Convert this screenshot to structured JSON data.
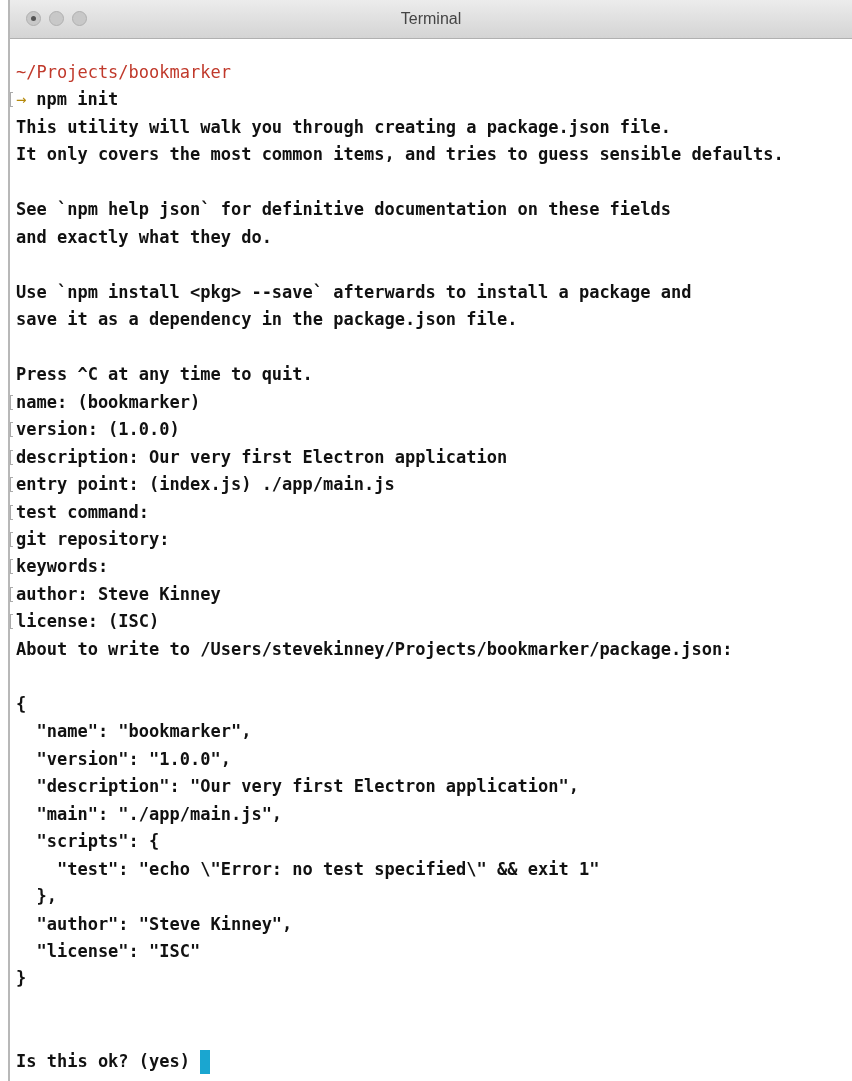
{
  "window": {
    "title": "Terminal"
  },
  "lines": [
    {
      "kind": "path",
      "text": "~/Projects/bookmarker",
      "marked": false
    },
    {
      "kind": "prompt",
      "symbol": "→",
      "text": "npm init",
      "marked": true
    },
    {
      "kind": "output",
      "text": "This utility will walk you through creating a package.json file.",
      "marked": false
    },
    {
      "kind": "output",
      "text": "It only covers the most common items, and tries to guess sensible defaults.",
      "marked": false
    },
    {
      "kind": "blank"
    },
    {
      "kind": "output",
      "text": "See `npm help json` for definitive documentation on these fields",
      "marked": false
    },
    {
      "kind": "output",
      "text": "and exactly what they do.",
      "marked": false
    },
    {
      "kind": "blank"
    },
    {
      "kind": "output",
      "text": "Use `npm install <pkg> --save` afterwards to install a package and",
      "marked": false
    },
    {
      "kind": "output",
      "text": "save it as a dependency in the package.json file.",
      "marked": false
    },
    {
      "kind": "blank"
    },
    {
      "kind": "output",
      "text": "Press ^C at any time to quit.",
      "marked": false
    },
    {
      "kind": "output",
      "text": "name: (bookmarker)",
      "marked": true
    },
    {
      "kind": "output",
      "text": "version: (1.0.0)",
      "marked": true
    },
    {
      "kind": "output",
      "text": "description: Our very first Electron application",
      "marked": true
    },
    {
      "kind": "output",
      "text": "entry point: (index.js) ./app/main.js",
      "marked": true
    },
    {
      "kind": "output",
      "text": "test command:",
      "marked": true
    },
    {
      "kind": "output",
      "text": "git repository:",
      "marked": true
    },
    {
      "kind": "output",
      "text": "keywords:",
      "marked": true
    },
    {
      "kind": "output",
      "text": "author: Steve Kinney",
      "marked": true
    },
    {
      "kind": "output",
      "text": "license: (ISC)",
      "marked": true
    },
    {
      "kind": "output",
      "text": "About to write to /Users/stevekinney/Projects/bookmarker/package.json:",
      "marked": false
    },
    {
      "kind": "blank"
    },
    {
      "kind": "output",
      "text": "{",
      "marked": false
    },
    {
      "kind": "output",
      "text": "  \"name\": \"bookmarker\",",
      "marked": false
    },
    {
      "kind": "output",
      "text": "  \"version\": \"1.0.0\",",
      "marked": false
    },
    {
      "kind": "output",
      "text": "  \"description\": \"Our very first Electron application\",",
      "marked": false
    },
    {
      "kind": "output",
      "text": "  \"main\": \"./app/main.js\",",
      "marked": false
    },
    {
      "kind": "output",
      "text": "  \"scripts\": {",
      "marked": false
    },
    {
      "kind": "output",
      "text": "    \"test\": \"echo \\\"Error: no test specified\\\" && exit 1\"",
      "marked": false
    },
    {
      "kind": "output",
      "text": "  },",
      "marked": false
    },
    {
      "kind": "output",
      "text": "  \"author\": \"Steve Kinney\",",
      "marked": false
    },
    {
      "kind": "output",
      "text": "  \"license\": \"ISC\"",
      "marked": false
    },
    {
      "kind": "output",
      "text": "}",
      "marked": false
    },
    {
      "kind": "blank"
    },
    {
      "kind": "blank"
    },
    {
      "kind": "output",
      "text": "Is this ok? (yes)",
      "marked": false,
      "cursor": true
    }
  ]
}
